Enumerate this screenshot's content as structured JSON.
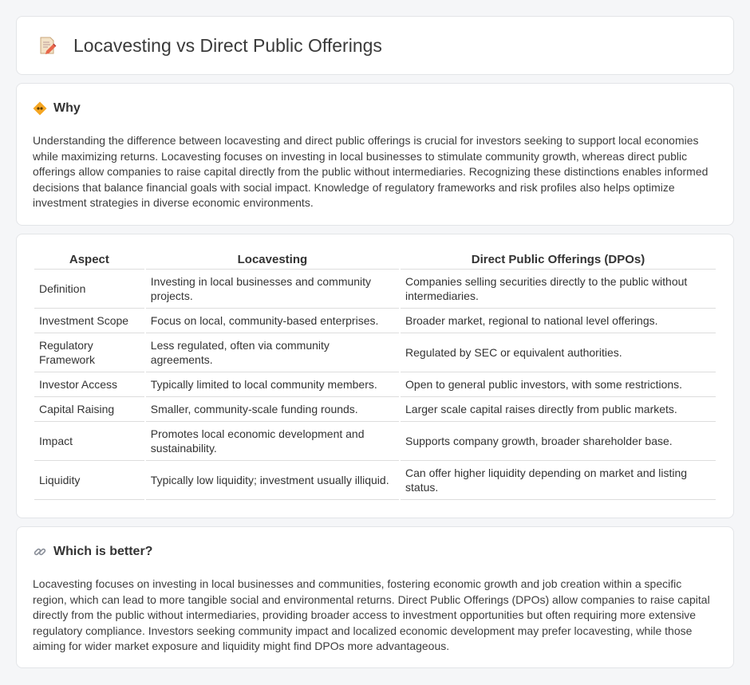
{
  "page": {
    "title": "Locavesting vs Direct Public Offerings",
    "title_icon": "memo-pencil-icon"
  },
  "why": {
    "icon": "diamond-sign-icon",
    "heading": "Why",
    "text": "Understanding the difference between locavesting and direct public offerings is crucial for investors seeking to support local economies while maximizing returns. Locavesting focuses on investing in local businesses to stimulate community growth, whereas direct public offerings allow companies to raise capital directly from the public without intermediaries. Recognizing these distinctions enables informed decisions that balance financial goals with social impact. Knowledge of regulatory frameworks and risk profiles also helps optimize investment strategies in diverse economic environments."
  },
  "comparison": {
    "headers": [
      "Aspect",
      "Locavesting",
      "Direct Public Offerings (DPOs)"
    ],
    "rows": [
      [
        "Definition",
        "Investing in local businesses and community projects.",
        "Companies selling securities directly to the public without intermediaries."
      ],
      [
        "Investment Scope",
        "Focus on local, community-based enterprises.",
        "Broader market, regional to national level offerings."
      ],
      [
        "Regulatory Framework",
        "Less regulated, often via community agreements.",
        "Regulated by SEC or equivalent authorities."
      ],
      [
        "Investor Access",
        "Typically limited to local community members.",
        "Open to general public investors, with some restrictions."
      ],
      [
        "Capital Raising",
        "Smaller, community-scale funding rounds.",
        "Larger scale capital raises directly from public markets."
      ],
      [
        "Impact",
        "Promotes local economic development and sustainability.",
        "Supports company growth, broader shareholder base."
      ],
      [
        "Liquidity",
        "Typically low liquidity; investment usually illiquid.",
        "Can offer higher liquidity depending on market and listing status."
      ]
    ]
  },
  "better": {
    "icon": "link-icon",
    "heading": "Which is better?",
    "text": "Locavesting focuses on investing in local businesses and communities, fostering economic growth and job creation within a specific region, which can lead to more tangible social and environmental returns. Direct Public Offerings (DPOs) allow companies to raise capital directly from the public without intermediaries, providing broader access to investment opportunities but often requiring more extensive regulatory compliance. Investors seeking community impact and localized economic development may prefer locavesting, while those aiming for wider market exposure and liquidity might find DPOs more advantageous."
  }
}
